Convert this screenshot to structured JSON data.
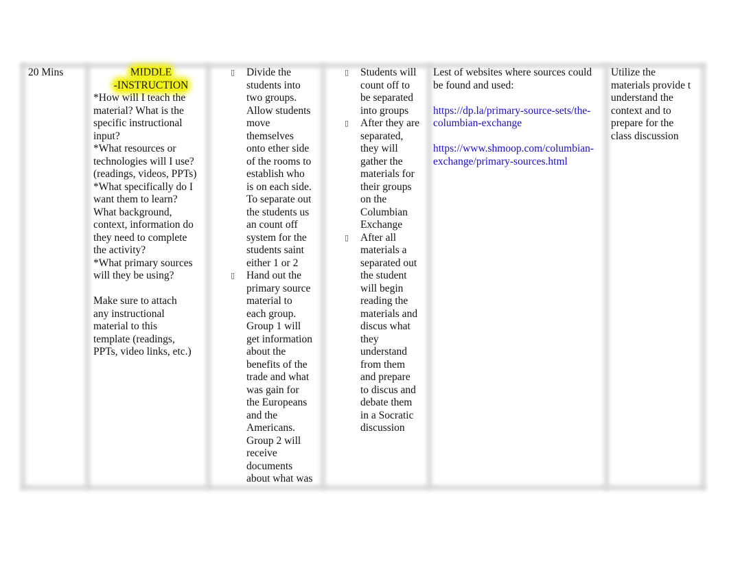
{
  "time": "20 Mins",
  "phase": {
    "heading": [
      "MIDDLE",
      "-INSTRUCTION"
    ],
    "highlight_color": "#f2f21a",
    "lines": [
      "*How will I teach the",
      "material? What is the",
      "specific instructional",
      "input?",
      "*What resources or",
      "technologies will I use?",
      "(readings, videos, PPTs)",
      "*What specifically do I",
      "want them to learn?",
      "What background,",
      "context, information do",
      "they need to complete",
      "the activity?",
      "*What primary sources",
      "will they be using?",
      "",
      "Make sure to attach",
      "any instructional",
      "material to this",
      "template (readings,",
      "PPTs, video links, etc.)"
    ]
  },
  "teacher": {
    "bullet_icon": "bullet-icon",
    "items": [
      [
        "Divide the",
        "students into",
        "two groups.",
        "Allow students",
        "move",
        "themselves",
        "onto ether side",
        "of the rooms to",
        "establish who",
        "is on each side.",
        "To separate out",
        "the students us",
        "an count off",
        "system for the",
        "students saint",
        "either 1 or 2"
      ],
      [
        "Hand out the",
        "primary source",
        "material to",
        "each group.",
        "Group 1 will",
        "get information",
        "about the",
        "benefits of the",
        "trade and what",
        "was gain for",
        "the Europeans",
        "and the",
        "Americans.",
        "Group 2 will",
        "receive",
        "documents",
        "about what was"
      ]
    ]
  },
  "students": {
    "items": [
      [
        "Students will",
        "count off to",
        "be separated",
        "into groups"
      ],
      [
        "After they are",
        "separated,",
        "they will",
        "gather the",
        "materials for",
        "their groups",
        "on the",
        "Columbian",
        "Exchange"
      ],
      [
        "After all",
        "materials a",
        "separated out",
        "the student",
        "will begin",
        "reading the",
        "materials and",
        "discus what",
        "they",
        "understand",
        "from them",
        "and prepare",
        "to discus and",
        "debate them",
        "in a Socratic",
        "discussion"
      ]
    ]
  },
  "resources": {
    "intro": [
      "Lest of websites where sources could",
      "be found and used:"
    ],
    "links": [
      [
        "https://dp.la/primary-source-sets/the-",
        "columbian-exchange"
      ],
      [
        "https://www.shmoop.com/columbian-",
        "exchange/primary-sources.html"
      ]
    ],
    "link_color": "#1a0dcc"
  },
  "assessment": [
    "Utilize the",
    "materials provide t",
    "understand the",
    "context and to",
    "prepare for the",
    "class discussion"
  ]
}
